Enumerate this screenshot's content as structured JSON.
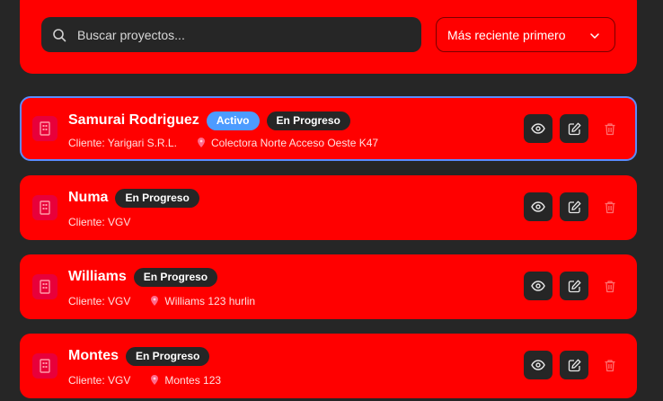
{
  "search": {
    "placeholder": "Buscar proyectos..."
  },
  "sort": {
    "selected": "Más reciente primero"
  },
  "projects": [
    {
      "name": "Samurai Rodriguez",
      "active_badge": "Activo",
      "status": "En Progreso",
      "client": "Cliente: Yarigari S.R.L.",
      "location": "Colectora Norte Acceso Oeste K47"
    },
    {
      "name": "Numa",
      "status": "En Progreso",
      "client": "Cliente: VGV"
    },
    {
      "name": "Williams",
      "status": "En Progreso",
      "client": "Cliente: VGV",
      "location": "Williams 123 hurlin"
    },
    {
      "name": "Montes",
      "status": "En Progreso",
      "client": "Cliente: VGV",
      "location": "Montes 123"
    }
  ],
  "colors": {
    "background": "#262626",
    "card": "#ff0000",
    "accent": "#4d9bff",
    "selected_border": "#5a8cff"
  },
  "icons": {
    "search": "search-icon",
    "sort": "chevron-down-icon",
    "project": "building-icon",
    "location": "map-pin-icon",
    "view": "eye-icon",
    "edit": "edit-icon",
    "delete": "trash-icon"
  }
}
